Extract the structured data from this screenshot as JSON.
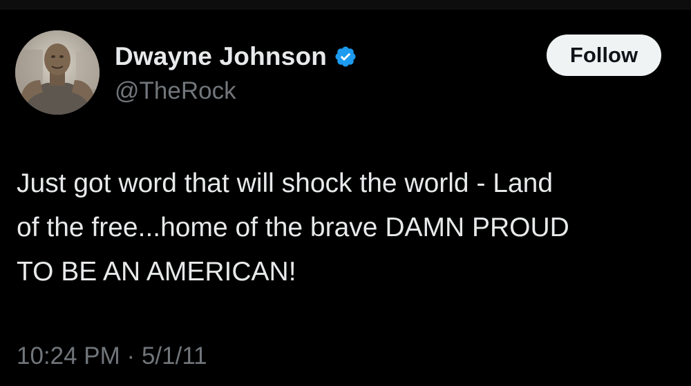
{
  "author": {
    "display_name": "Dwayne Johnson",
    "handle": "@TheRock",
    "verified": true,
    "verified_color": "#1d9bf0",
    "avatar_icon": "profile-photo"
  },
  "actions": {
    "follow_label": "Follow"
  },
  "tweet": {
    "lines": [
      "Just got word that will shock the world - Land",
      "of the free...home of the brave DAMN PROUD",
      "TO BE AN AMERICAN!"
    ],
    "time": "10:24 PM",
    "separator": "·",
    "date": "5/1/11"
  },
  "colors": {
    "background": "#000000",
    "primary_text": "#e7e9ea",
    "secondary_text": "#71767b",
    "button_bg": "#eff3f4",
    "button_text": "#0f1419"
  }
}
